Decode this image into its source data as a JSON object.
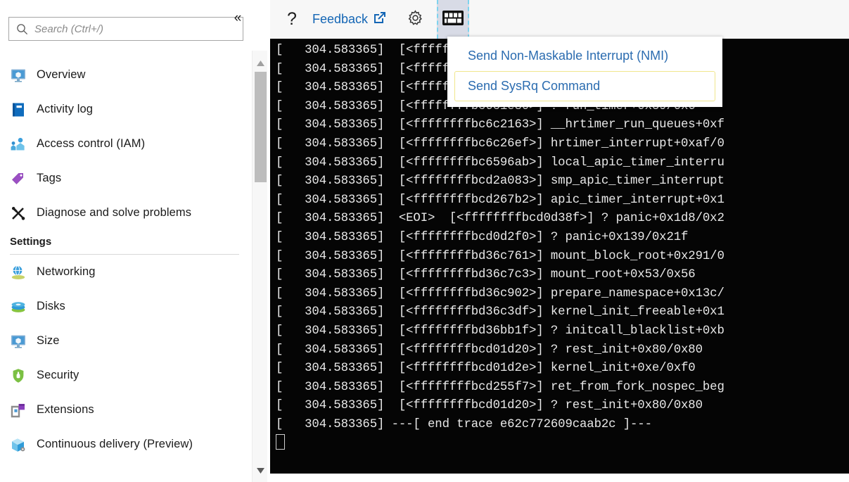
{
  "sidebar": {
    "search": {
      "placeholder": "Search (Ctrl+/)",
      "value": "",
      "icon": "search-icon"
    },
    "collapse": {
      "label": "«",
      "icon": "chevron-double-left-icon"
    },
    "items": [
      {
        "label": "Overview",
        "icon": "monitor-icon"
      },
      {
        "label": "Activity log",
        "icon": "book-icon"
      },
      {
        "label": "Access control (IAM)",
        "icon": "people-icon"
      },
      {
        "label": "Tags",
        "icon": "tag-icon"
      },
      {
        "label": "Diagnose and solve problems",
        "icon": "wrench-screwdriver-icon"
      }
    ],
    "settings_header": "Settings",
    "settings_items": [
      {
        "label": "Networking",
        "icon": "network-globe-icon"
      },
      {
        "label": "Disks",
        "icon": "disk-icon"
      },
      {
        "label": "Size",
        "icon": "monitor-size-icon"
      },
      {
        "label": "Security",
        "icon": "shield-lock-icon"
      },
      {
        "label": "Extensions",
        "icon": "extensions-icon"
      },
      {
        "label": "Continuous delivery (Preview)",
        "icon": "delivery-box-icon"
      }
    ],
    "scrollbar": {
      "up_arrow": "▲",
      "down_arrow": "▼"
    }
  },
  "toolbar": {
    "help_label": "?",
    "help_icon": "question-mark-icon",
    "feedback_label": "Feedback",
    "feedback_icon": "external-link-icon",
    "settings_icon": "gear-icon",
    "keyboard_icon": "keyboard-icon"
  },
  "menu": {
    "items": [
      {
        "label": "Send Non-Maskable Interrupt (NMI)",
        "focused": false
      },
      {
        "label": "Send SysRq Command",
        "focused": true
      }
    ]
  },
  "terminal": {
    "timestamp": "304.583365",
    "lines": [
      "[   304.583365]  [<ffffffffbc6bbc3b>] ? sched_do_timer+0x2",
      "[   304.583365]  [<ffffffffbc6b9f2a>] ? process_times+0x64",
      "[   304.583365]  [<ffffffffbc6c1a40>] ? timer_handle+0x30/0",
      "[   304.583365]  [<ffffffffbc6c1e80>] ? run_timer+0x39/0x6",
      "[   304.583365]  [<ffffffffbc6c2163>] __hrtimer_run_queues+0xf",
      "[   304.583365]  [<ffffffffbc6c26ef>] hrtimer_interrupt+0xaf/0",
      "[   304.583365]  [<ffffffffbc6596ab>] local_apic_timer_interru",
      "[   304.583365]  [<ffffffffbcd2a083>] smp_apic_timer_interrupt",
      "[   304.583365]  [<ffffffffbcd267b2>] apic_timer_interrupt+0x1",
      "[   304.583365]  <EOI>  [<ffffffffbcd0d38f>] ? panic+0x1d8/0x2",
      "[   304.583365]  [<ffffffffbcd0d2f0>] ? panic+0x139/0x21f",
      "[   304.583365]  [<ffffffffbd36c761>] mount_block_root+0x291/0",
      "[   304.583365]  [<ffffffffbd36c7c3>] mount_root+0x53/0x56",
      "[   304.583365]  [<ffffffffbd36c902>] prepare_namespace+0x13c/",
      "[   304.583365]  [<ffffffffbd36c3df>] kernel_init_freeable+0x1",
      "[   304.583365]  [<ffffffffbd36bb1f>] ? initcall_blacklist+0xb",
      "[   304.583365]  [<ffffffffbcd01d20>] ? rest_init+0x80/0x80",
      "[   304.583365]  [<ffffffffbcd01d2e>] kernel_init+0xe/0xf0",
      "[   304.583365]  [<ffffffffbcd255f7>] ret_from_fork_nospec_beg",
      "[   304.583365]  [<ffffffffbcd01d20>] ? rest_init+0x80/0x80",
      "[   304.583365] ---[ end trace e62c772609caab2c ]---"
    ],
    "cursor": "block-cursor"
  },
  "colors": {
    "accent_blue": "#0f6cbd",
    "menu_link": "#2b6cb0",
    "terminal_bg": "#050505",
    "terminal_fg": "#e8e8e8",
    "toolbar_bg": "#f7f7f7",
    "focus_ring": "#f0e68c",
    "keyboard_selected_bg": "#d8dbe6"
  }
}
